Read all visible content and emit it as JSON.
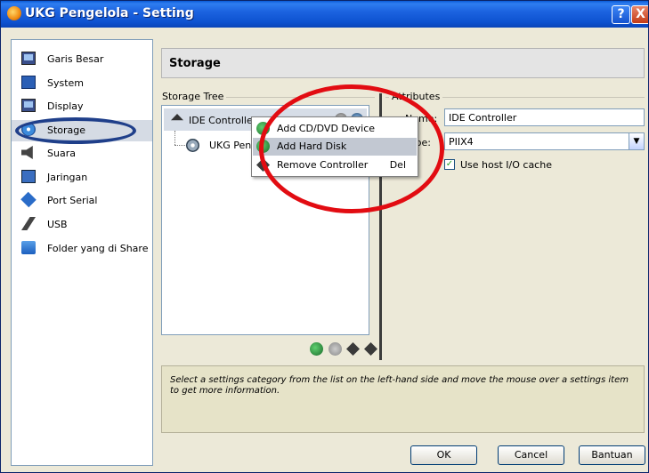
{
  "window": {
    "title": "UKG Pengelola - Setting",
    "help_glyph": "?",
    "close_glyph": "X"
  },
  "sidebar": {
    "items": [
      {
        "label": "Garis Besar",
        "icon": "monitor-icon"
      },
      {
        "label": "System",
        "icon": "chip-icon"
      },
      {
        "label": "Display",
        "icon": "display-icon"
      },
      {
        "label": "Storage",
        "icon": "storage-icon",
        "selected": true
      },
      {
        "label": "Suara",
        "icon": "speaker-icon"
      },
      {
        "label": "Jaringan",
        "icon": "network-icon"
      },
      {
        "label": "Port Serial",
        "icon": "serial-port-icon"
      },
      {
        "label": "USB",
        "icon": "usb-icon"
      },
      {
        "label": "Folder yang di Share",
        "icon": "folder-icon"
      }
    ]
  },
  "page": {
    "title": "Storage"
  },
  "storage_tree": {
    "label": "Storage Tree",
    "controller_label": "IDE Controlle",
    "disk_label": "UKG Pen"
  },
  "context_menu": {
    "items": [
      {
        "label": "Add CD/DVD Device",
        "shortcut": ""
      },
      {
        "label": "Add Hard Disk",
        "shortcut": "",
        "highlighted": true
      },
      {
        "label": "Remove Controller",
        "shortcut": "Del"
      }
    ]
  },
  "attributes": {
    "label": "Attributes",
    "name_label": "Name:",
    "name_value": "IDE Controller",
    "type_label": "Type:",
    "type_value": "PIIX4",
    "use_host_cache_label": "Use host I/O cache",
    "use_host_cache_checked": true
  },
  "info_text": "Select a settings category from the list on the left-hand side and move the mouse over a settings item to get more information.",
  "buttons": {
    "ok": "OK",
    "cancel": "Cancel",
    "help": "Bantuan"
  },
  "colors": {
    "highlight_red": "#e20c12",
    "highlight_blue": "#1f3f8a",
    "titlebar": "#0a5bd6"
  }
}
